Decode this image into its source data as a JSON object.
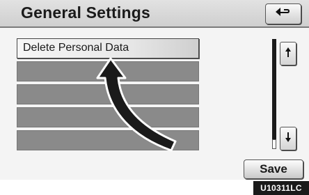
{
  "header": {
    "title": "General Settings",
    "back_icon": "return-arrow-icon"
  },
  "list": {
    "items": [
      {
        "label": "Delete Personal Data",
        "enabled": true
      },
      {
        "label": "",
        "enabled": false
      },
      {
        "label": "",
        "enabled": false
      },
      {
        "label": "",
        "enabled": false
      },
      {
        "label": "",
        "enabled": false
      }
    ]
  },
  "scroll": {
    "up_icon": "scroll-up-icon",
    "down_icon": "scroll-down-icon"
  },
  "footer": {
    "save_label": "Save"
  },
  "figure_code": "U10311LC",
  "colors": {
    "header_bg": "#d8d8d8",
    "disabled_row": "#8a8a8a",
    "pointer_arrow": "#1a1a1a"
  }
}
